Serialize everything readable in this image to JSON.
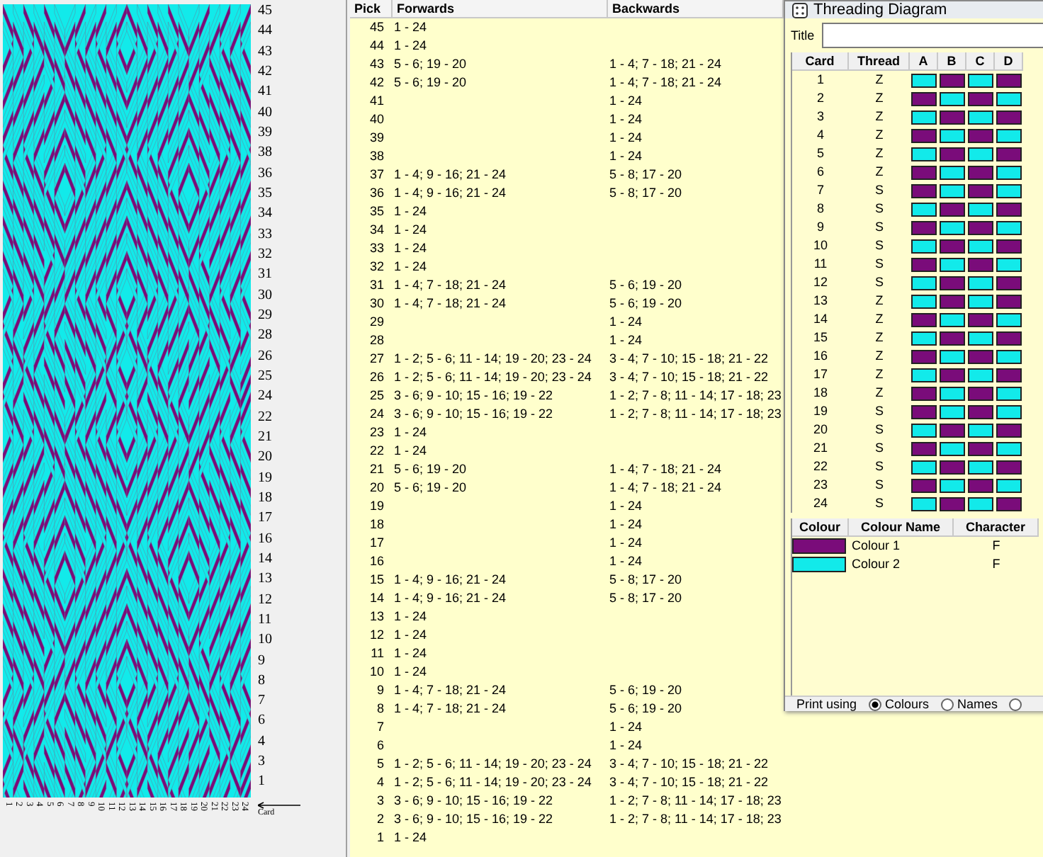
{
  "pattern_panel": {
    "pick_labels": [
      "45",
      "44",
      "43",
      "42",
      "41",
      "40",
      "39",
      "38",
      "36",
      "35",
      "34",
      "33",
      "32",
      "31",
      "30",
      "29",
      "28",
      "26",
      "25",
      "24",
      "22",
      "21",
      "20",
      "19",
      "18",
      "17",
      "16",
      "14",
      "13",
      "12",
      "11",
      "10",
      "9",
      "8",
      "7",
      "6",
      "4",
      "3",
      "1"
    ],
    "card_labels": [
      "1",
      "2",
      "3",
      "4",
      "5",
      "6",
      "7",
      "8",
      "9",
      "10",
      "11",
      "12",
      "13",
      "14",
      "15",
      "16",
      "17",
      "18",
      "19",
      "20",
      "21",
      "22",
      "23",
      "24"
    ],
    "axis_label": "Card"
  },
  "pick_table": {
    "columns": [
      "Pick",
      "Forwards",
      "Backwards"
    ],
    "rows": [
      {
        "pick": "45",
        "forwards": "1 - 24"
      },
      {
        "pick": "44",
        "forwards": "1 - 24"
      },
      {
        "pick": "43",
        "forwards": "5 - 6; 19 - 20",
        "backwards": "1 - 4; 7 - 18; 21 - 24"
      },
      {
        "pick": "42",
        "forwards": "5 - 6; 19 - 20",
        "backwards": "1 - 4; 7 - 18; 21 - 24"
      },
      {
        "pick": "41",
        "backwards": "1 - 24"
      },
      {
        "pick": "40",
        "backwards": "1 - 24"
      },
      {
        "pick": "39",
        "backwards": "1 - 24"
      },
      {
        "pick": "38",
        "backwards": "1 - 24"
      },
      {
        "pick": "37",
        "forwards": "1 - 4; 9 - 16; 21 - 24",
        "backwards": "5 - 8; 17 - 20"
      },
      {
        "pick": "36",
        "forwards": "1 - 4; 9 - 16; 21 - 24",
        "backwards": "5 - 8; 17 - 20"
      },
      {
        "pick": "35",
        "forwards": "1 - 24"
      },
      {
        "pick": "34",
        "forwards": "1 - 24"
      },
      {
        "pick": "33",
        "forwards": "1 - 24"
      },
      {
        "pick": "32",
        "forwards": "1 - 24"
      },
      {
        "pick": "31",
        "forwards": "1 - 4; 7 - 18; 21 - 24",
        "backwards": "5 - 6; 19 - 20"
      },
      {
        "pick": "30",
        "forwards": "1 - 4; 7 - 18; 21 - 24",
        "backwards": "5 - 6; 19 - 20"
      },
      {
        "pick": "29",
        "backwards": "1 - 24"
      },
      {
        "pick": "28",
        "backwards": "1 - 24"
      },
      {
        "pick": "27",
        "forwards": "1 - 2; 5 - 6; 11 - 14; 19 - 20; 23 - 24",
        "backwards": "3 - 4; 7 - 10; 15 - 18; 21 - 22"
      },
      {
        "pick": "26",
        "forwards": "1 - 2; 5 - 6; 11 - 14; 19 - 20; 23 - 24",
        "backwards": "3 - 4; 7 - 10; 15 - 18; 21 - 22"
      },
      {
        "pick": "25",
        "forwards": "3 - 6; 9 - 10; 15 - 16; 19 - 22",
        "backwards": "1 - 2; 7 - 8; 11 - 14; 17 - 18; 23"
      },
      {
        "pick": "24",
        "forwards": "3 - 6; 9 - 10; 15 - 16; 19 - 22",
        "backwards": "1 - 2; 7 - 8; 11 - 14; 17 - 18; 23"
      },
      {
        "pick": "23",
        "forwards": "1 - 24"
      },
      {
        "pick": "22",
        "forwards": "1 - 24"
      },
      {
        "pick": "21",
        "forwards": "5 - 6; 19 - 20",
        "backwards": "1 - 4; 7 - 18; 21 - 24"
      },
      {
        "pick": "20",
        "forwards": "5 - 6; 19 - 20",
        "backwards": "1 - 4; 7 - 18; 21 - 24"
      },
      {
        "pick": "19",
        "backwards": "1 - 24"
      },
      {
        "pick": "18",
        "backwards": "1 - 24"
      },
      {
        "pick": "17",
        "backwards": "1 - 24"
      },
      {
        "pick": "16",
        "backwards": "1 - 24"
      },
      {
        "pick": "15",
        "forwards": "1 - 4; 9 - 16; 21 - 24",
        "backwards": "5 - 8; 17 - 20"
      },
      {
        "pick": "14",
        "forwards": "1 - 4; 9 - 16; 21 - 24",
        "backwards": "5 - 8; 17 - 20"
      },
      {
        "pick": "13",
        "forwards": "1 - 24"
      },
      {
        "pick": "12",
        "forwards": "1 - 24"
      },
      {
        "pick": "11",
        "forwards": "1 - 24"
      },
      {
        "pick": "10",
        "forwards": "1 - 24"
      },
      {
        "pick": "9",
        "forwards": "1 - 4; 7 - 18; 21 - 24",
        "backwards": "5 - 6; 19 - 20"
      },
      {
        "pick": "8",
        "forwards": "1 - 4; 7 - 18; 21 - 24",
        "backwards": "5 - 6; 19 - 20"
      },
      {
        "pick": "7",
        "backwards": "1 - 24"
      },
      {
        "pick": "6",
        "backwards": "1 - 24"
      },
      {
        "pick": "5",
        "forwards": "1 - 2; 5 - 6; 11 - 14; 19 - 20; 23 - 24",
        "backwards": "3 - 4; 7 - 10; 15 - 18; 21 - 22"
      },
      {
        "pick": "4",
        "forwards": "1 - 2; 5 - 6; 11 - 14; 19 - 20; 23 - 24",
        "backwards": "3 - 4; 7 - 10; 15 - 18; 21 - 22"
      },
      {
        "pick": "3",
        "forwards": "3 - 6; 9 - 10; 15 - 16; 19 - 22",
        "backwards": "1 - 2; 7 - 8; 11 - 14; 17 - 18; 23"
      },
      {
        "pick": "2",
        "forwards": "3 - 6; 9 - 10; 15 - 16; 19 - 22",
        "backwards": "1 - 2; 7 - 8; 11 - 14; 17 - 18; 23"
      },
      {
        "pick": "1",
        "forwards": "1 - 24"
      }
    ]
  },
  "threading_window": {
    "title": "Threading Diagram",
    "title_label": "Title",
    "card_columns": [
      "Card",
      "Thread",
      "A",
      "B",
      "C",
      "D"
    ],
    "cards": [
      {
        "card": "1",
        "thread": "Z",
        "holes": [
          {
            "color": "#12eaea"
          },
          {
            "color": "#7a0c7a"
          },
          {
            "color": "#12eaea"
          },
          {
            "color": "#7a0c7a"
          }
        ]
      },
      {
        "card": "2",
        "thread": "Z",
        "holes": [
          {
            "color": "#7a0c7a"
          },
          {
            "color": "#12eaea"
          },
          {
            "color": "#7a0c7a"
          },
          {
            "color": "#12eaea"
          }
        ]
      },
      {
        "card": "3",
        "thread": "Z",
        "holes": [
          {
            "color": "#12eaea"
          },
          {
            "color": "#7a0c7a"
          },
          {
            "color": "#12eaea"
          },
          {
            "color": "#7a0c7a"
          }
        ]
      },
      {
        "card": "4",
        "thread": "Z",
        "holes": [
          {
            "color": "#7a0c7a"
          },
          {
            "color": "#12eaea"
          },
          {
            "color": "#7a0c7a"
          },
          {
            "color": "#12eaea"
          }
        ]
      },
      {
        "card": "5",
        "thread": "Z",
        "holes": [
          {
            "color": "#12eaea"
          },
          {
            "color": "#7a0c7a"
          },
          {
            "color": "#12eaea"
          },
          {
            "color": "#7a0c7a"
          }
        ]
      },
      {
        "card": "6",
        "thread": "Z",
        "holes": [
          {
            "color": "#7a0c7a"
          },
          {
            "color": "#12eaea"
          },
          {
            "color": "#7a0c7a"
          },
          {
            "color": "#12eaea"
          }
        ]
      },
      {
        "card": "7",
        "thread": "S",
        "holes": [
          {
            "color": "#7a0c7a"
          },
          {
            "color": "#12eaea"
          },
          {
            "color": "#7a0c7a"
          },
          {
            "color": "#12eaea"
          }
        ]
      },
      {
        "card": "8",
        "thread": "S",
        "holes": [
          {
            "color": "#12eaea"
          },
          {
            "color": "#7a0c7a"
          },
          {
            "color": "#12eaea"
          },
          {
            "color": "#7a0c7a"
          }
        ]
      },
      {
        "card": "9",
        "thread": "S",
        "holes": [
          {
            "color": "#7a0c7a"
          },
          {
            "color": "#12eaea"
          },
          {
            "color": "#7a0c7a"
          },
          {
            "color": "#12eaea"
          }
        ]
      },
      {
        "card": "10",
        "thread": "S",
        "holes": [
          {
            "color": "#12eaea"
          },
          {
            "color": "#7a0c7a"
          },
          {
            "color": "#12eaea"
          },
          {
            "color": "#7a0c7a"
          }
        ]
      },
      {
        "card": "11",
        "thread": "S",
        "holes": [
          {
            "color": "#7a0c7a"
          },
          {
            "color": "#12eaea"
          },
          {
            "color": "#7a0c7a"
          },
          {
            "color": "#12eaea"
          }
        ]
      },
      {
        "card": "12",
        "thread": "S",
        "holes": [
          {
            "color": "#12eaea"
          },
          {
            "color": "#7a0c7a"
          },
          {
            "color": "#12eaea"
          },
          {
            "color": "#7a0c7a"
          }
        ]
      },
      {
        "card": "13",
        "thread": "Z",
        "holes": [
          {
            "color": "#12eaea"
          },
          {
            "color": "#7a0c7a"
          },
          {
            "color": "#12eaea"
          },
          {
            "color": "#7a0c7a"
          }
        ]
      },
      {
        "card": "14",
        "thread": "Z",
        "holes": [
          {
            "color": "#7a0c7a"
          },
          {
            "color": "#12eaea"
          },
          {
            "color": "#7a0c7a"
          },
          {
            "color": "#12eaea"
          }
        ]
      },
      {
        "card": "15",
        "thread": "Z",
        "holes": [
          {
            "color": "#12eaea"
          },
          {
            "color": "#7a0c7a"
          },
          {
            "color": "#12eaea"
          },
          {
            "color": "#7a0c7a"
          }
        ]
      },
      {
        "card": "16",
        "thread": "Z",
        "holes": [
          {
            "color": "#7a0c7a"
          },
          {
            "color": "#12eaea"
          },
          {
            "color": "#7a0c7a"
          },
          {
            "color": "#12eaea"
          }
        ]
      },
      {
        "card": "17",
        "thread": "Z",
        "holes": [
          {
            "color": "#12eaea"
          },
          {
            "color": "#7a0c7a"
          },
          {
            "color": "#12eaea"
          },
          {
            "color": "#7a0c7a"
          }
        ]
      },
      {
        "card": "18",
        "thread": "Z",
        "holes": [
          {
            "color": "#7a0c7a"
          },
          {
            "color": "#12eaea"
          },
          {
            "color": "#7a0c7a"
          },
          {
            "color": "#12eaea"
          }
        ]
      },
      {
        "card": "19",
        "thread": "S",
        "holes": [
          {
            "color": "#7a0c7a"
          },
          {
            "color": "#12eaea"
          },
          {
            "color": "#7a0c7a"
          },
          {
            "color": "#12eaea"
          }
        ]
      },
      {
        "card": "20",
        "thread": "S",
        "holes": [
          {
            "color": "#12eaea"
          },
          {
            "color": "#7a0c7a"
          },
          {
            "color": "#12eaea"
          },
          {
            "color": "#7a0c7a"
          }
        ]
      },
      {
        "card": "21",
        "thread": "S",
        "holes": [
          {
            "color": "#7a0c7a"
          },
          {
            "color": "#12eaea"
          },
          {
            "color": "#7a0c7a"
          },
          {
            "color": "#12eaea"
          }
        ]
      },
      {
        "card": "22",
        "thread": "S",
        "holes": [
          {
            "color": "#12eaea"
          },
          {
            "color": "#7a0c7a"
          },
          {
            "color": "#12eaea"
          },
          {
            "color": "#7a0c7a"
          }
        ]
      },
      {
        "card": "23",
        "thread": "S",
        "holes": [
          {
            "color": "#7a0c7a"
          },
          {
            "color": "#12eaea"
          },
          {
            "color": "#7a0c7a"
          },
          {
            "color": "#12eaea"
          }
        ]
      },
      {
        "card": "24",
        "thread": "S",
        "holes": [
          {
            "color": "#12eaea"
          },
          {
            "color": "#7a0c7a"
          },
          {
            "color": "#12eaea"
          },
          {
            "color": "#7a0c7a"
          }
        ]
      }
    ],
    "colour_columns": [
      "Colour",
      "Colour Name",
      "Character"
    ],
    "colours": [
      {
        "name": "Colour 1",
        "character": "F",
        "color": "#7a0c7a"
      },
      {
        "name": "Colour 2",
        "character": "F",
        "color": "#12eaea"
      }
    ],
    "print_label": "Print using",
    "print_options": [
      {
        "label": "Colours",
        "selected": true
      },
      {
        "label": "Names",
        "selected": false
      },
      {
        "selected": false
      }
    ]
  }
}
